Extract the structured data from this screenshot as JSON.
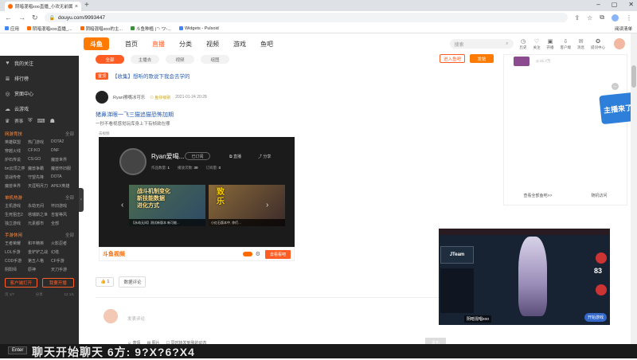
{
  "browser": {
    "tab_title": "阴暗混唱xoo直播_小欢无前属你",
    "url": "douyu.com/9993447",
    "bookmarks": [
      "应用",
      "阴暗混唱xoo直播_...",
      "阴暗混唱xoo的主...",
      "斗鱼种植 | \"◦ ワ◦...",
      "Widgets - Pulsoid"
    ],
    "bookmark_right": "阅读清单"
  },
  "site": {
    "logo": "斗鱼",
    "nav": [
      "首页",
      "直播",
      "分类",
      "视频",
      "游戏",
      "鱼吧"
    ],
    "search_placeholder": "搜索",
    "header_icons": [
      "历史",
      "关注",
      "开播",
      "客户端",
      "消息",
      "提问中心"
    ]
  },
  "sidebar": {
    "top": [
      "我的关注",
      "排行榜",
      "赏面中心",
      "云游戏"
    ],
    "games_label": "赛事",
    "sec1": {
      "title": "网游竞技",
      "more": "全部"
    },
    "sec1_items": [
      "英雄联盟",
      "热门游戏",
      "DOTA2",
      "穿越火线",
      "CF:KO",
      "DNF",
      "炉石传说",
      "CS:GO",
      "魔兽世界",
      "bn云顶之弈",
      "魔兽争霸",
      "魔兽怀旧服",
      "逆战传奇",
      "守望先锋",
      "DOTA",
      "魔兽世界",
      "天涯明月刀",
      "APEX英雄"
    ],
    "sec2": {
      "title": "单机热游",
      "more": "全部"
    },
    "sec2_items": [
      "主机游戏",
      "永劫无间",
      "怀旧游戏",
      "生死狙击2",
      "塔瑞斯之世",
      "吉客等风",
      "独立游戏",
      "元素都市",
      "全部"
    ],
    "sec3": {
      "title": "手游休闲",
      "more": "全部"
    },
    "sec3_items": [
      "王者荣耀",
      "和平精英",
      "火影忍者",
      "LOL手游",
      "金铲铲之战",
      "幻塔",
      "COD手游",
      "第五人格",
      "CF手游",
      "阴阳师",
      "原神",
      "天刀手游"
    ],
    "btns": [
      "客户端打开",
      "我要开播"
    ],
    "foot": [
      "页 1/7",
      "分享",
      "12 1/1"
    ]
  },
  "content": {
    "pills": [
      "全部",
      "主播去",
      "视频",
      "组图"
    ],
    "follow_label": "进入鱼吧",
    "post_label": "发帖",
    "tag": "置顶",
    "post_title": "【收集】想听的歌说下我会去学的",
    "author": "Ryan擦嘴冰可乐",
    "badge": "鱼仔级别",
    "time": "2021-01-24 20:28",
    "h": "猪鼻涕眼一飞三猫追猫恐怖加期",
    "sub": "一秒不看视感觉玩库身上下有帧欲在哪",
    "video_label": "去视频",
    "card": {
      "name": "Ryan爱喝...",
      "sub": "已订阅",
      "act1": "直播",
      "act2": "分享",
      "stats": [
        [
          "作品数量:",
          "1"
        ],
        [
          "播放次数:",
          "39"
        ],
        [
          "订阅量:",
          "0"
        ]
      ],
      "thumb1": "战斗机制变化\n新技能数据\n进化方式",
      "thumb1_bar": "【永劫无间】测试新版本 新可能...",
      "thumb2": "致\n乐",
      "thumb2_bar": "小红石版本中, 你们...",
      "brand": "斗鱼视频",
      "go": "去看看吧"
    },
    "like_count": "1",
    "report": "数据评论",
    "comment_placeholder": "发表评论",
    "tools": [
      "表情",
      "图片",
      "同时转发到我的动态"
    ],
    "send": "发布"
  },
  "right": {
    "meta": "◎ 21.7万",
    "links": [
      "查看全部鱼吧>>",
      "随机访问"
    ]
  },
  "ad": "主播来了",
  "game": {
    "team": "JTeam",
    "count": "83",
    "name": "阴暗混唱xoo",
    "start": "开始游戏"
  },
  "taskbar": {
    "enter": "Enter",
    "text": "聊天开始聊天  6方: 9?X?6?X4"
  }
}
